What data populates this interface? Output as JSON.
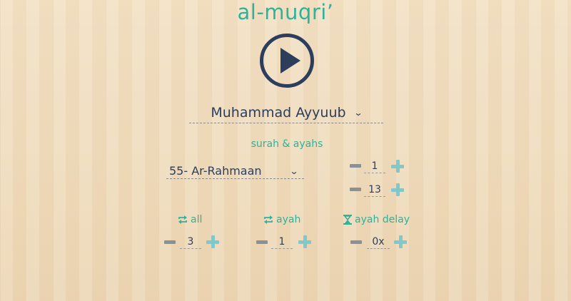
{
  "app": {
    "title": "al-muqri’"
  },
  "reciter": {
    "selected": "Muhammad Ayyuub"
  },
  "surah_section": {
    "label": "surah & ayahs",
    "surah_selected": "55- Ar-Rahmaan",
    "ayah_start": "1",
    "ayah_end": "13"
  },
  "repeat_all": {
    "label": "all",
    "value": "3"
  },
  "repeat_ayah": {
    "label": "ayah",
    "value": "1"
  },
  "ayah_delay": {
    "label": "ayah delay",
    "value": "0x"
  },
  "colors": {
    "accent": "#2fb29a",
    "text_dark": "#2c3e5c",
    "plus": "#7fc8cc",
    "minus": "#8a9093"
  }
}
